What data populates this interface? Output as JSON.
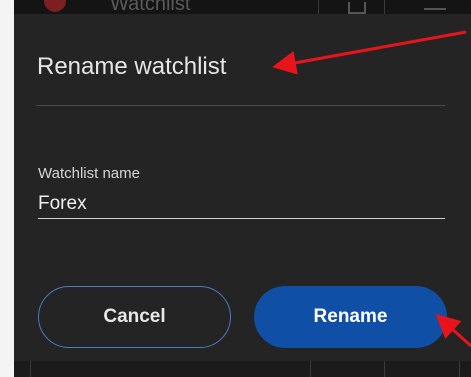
{
  "background_app": {
    "title": "Watchlist"
  },
  "dialog": {
    "title": "Rename watchlist",
    "field_label": "Watchlist name",
    "field_value": "Forex",
    "cancel_label": "Cancel",
    "rename_label": "Rename"
  },
  "colors": {
    "dialog_bg": "#242424",
    "primary_button": "#0f4fa6",
    "outline_button_border": "#4a7bc4",
    "annotation_arrow": "#e8141c"
  },
  "icons": [
    "avatar-icon",
    "edit-icon",
    "menu-icon",
    "annotation-arrow-icon"
  ]
}
